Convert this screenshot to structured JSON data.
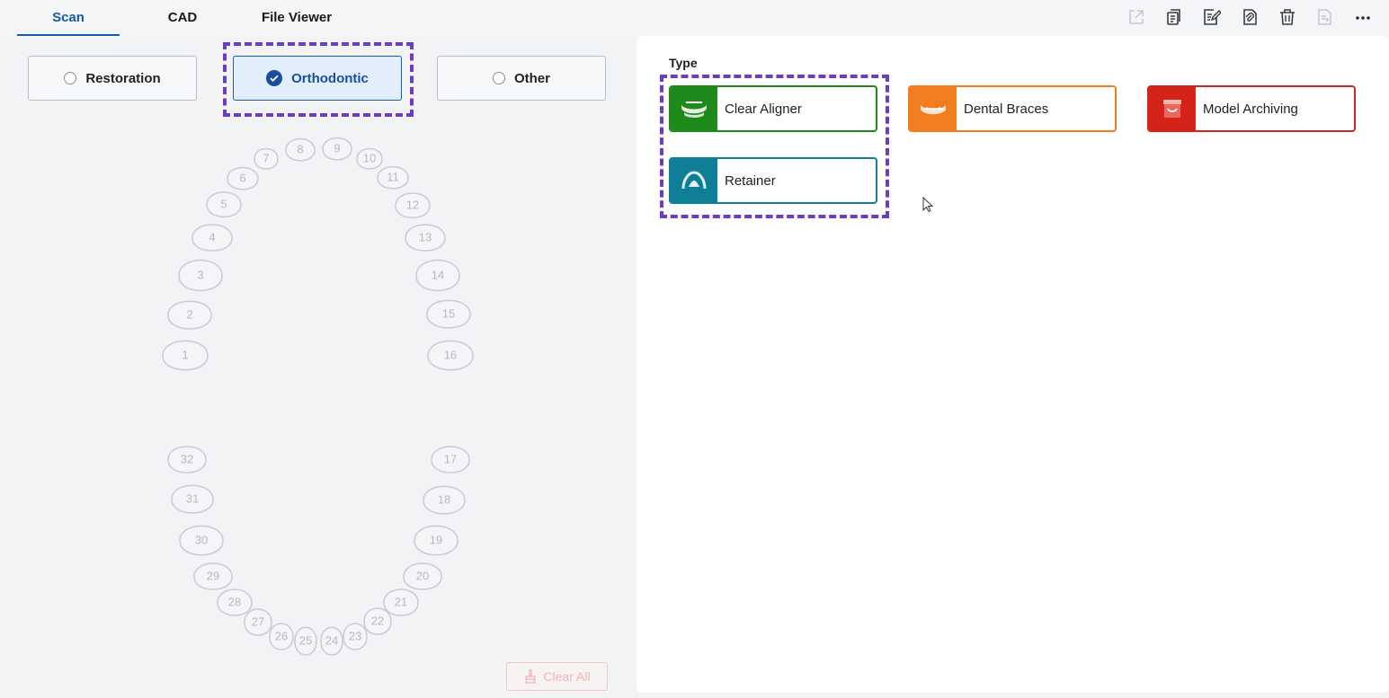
{
  "tabs": [
    {
      "label": "Scan",
      "active": true
    },
    {
      "label": "CAD",
      "active": false
    },
    {
      "label": "File Viewer",
      "active": false
    }
  ],
  "toolbar": [
    {
      "icon": "export-icon",
      "disabled": true
    },
    {
      "icon": "copy-document-icon",
      "disabled": false
    },
    {
      "icon": "edit-document-icon",
      "disabled": false
    },
    {
      "icon": "attachment-document-icon",
      "disabled": false
    },
    {
      "icon": "trash-icon",
      "disabled": false
    },
    {
      "icon": "send-document-icon",
      "disabled": true
    },
    {
      "icon": "more-icon",
      "disabled": false
    }
  ],
  "modes": [
    {
      "label": "Restoration",
      "selected": false
    },
    {
      "label": "Orthodontic",
      "selected": true
    },
    {
      "label": "Other",
      "selected": false
    }
  ],
  "teeth": {
    "upper": [
      "1",
      "2",
      "3",
      "4",
      "5",
      "6",
      "7",
      "8",
      "9",
      "10",
      "11",
      "12",
      "13",
      "14",
      "15",
      "16"
    ],
    "lower": [
      "17",
      "18",
      "19",
      "20",
      "21",
      "22",
      "23",
      "24",
      "25",
      "26",
      "27",
      "28",
      "29",
      "30",
      "31",
      "32"
    ]
  },
  "clear_all_label": "Clear All",
  "type_section": {
    "label": "Type",
    "items": [
      {
        "label": "Clear Aligner",
        "color": "#1f8a1c",
        "icon": "clear-aligner-icon"
      },
      {
        "label": "Dental Braces",
        "color": "#f07d1f",
        "icon": "dental-braces-icon"
      },
      {
        "label": "Model Archiving",
        "color": "#d42318",
        "icon": "model-archiving-icon"
      },
      {
        "label": "Retainer",
        "color": "#0f7f98",
        "icon": "retainer-icon"
      }
    ]
  },
  "colors": {
    "accent": "#1859a8",
    "highlight_dash": "#6a3cc7"
  }
}
